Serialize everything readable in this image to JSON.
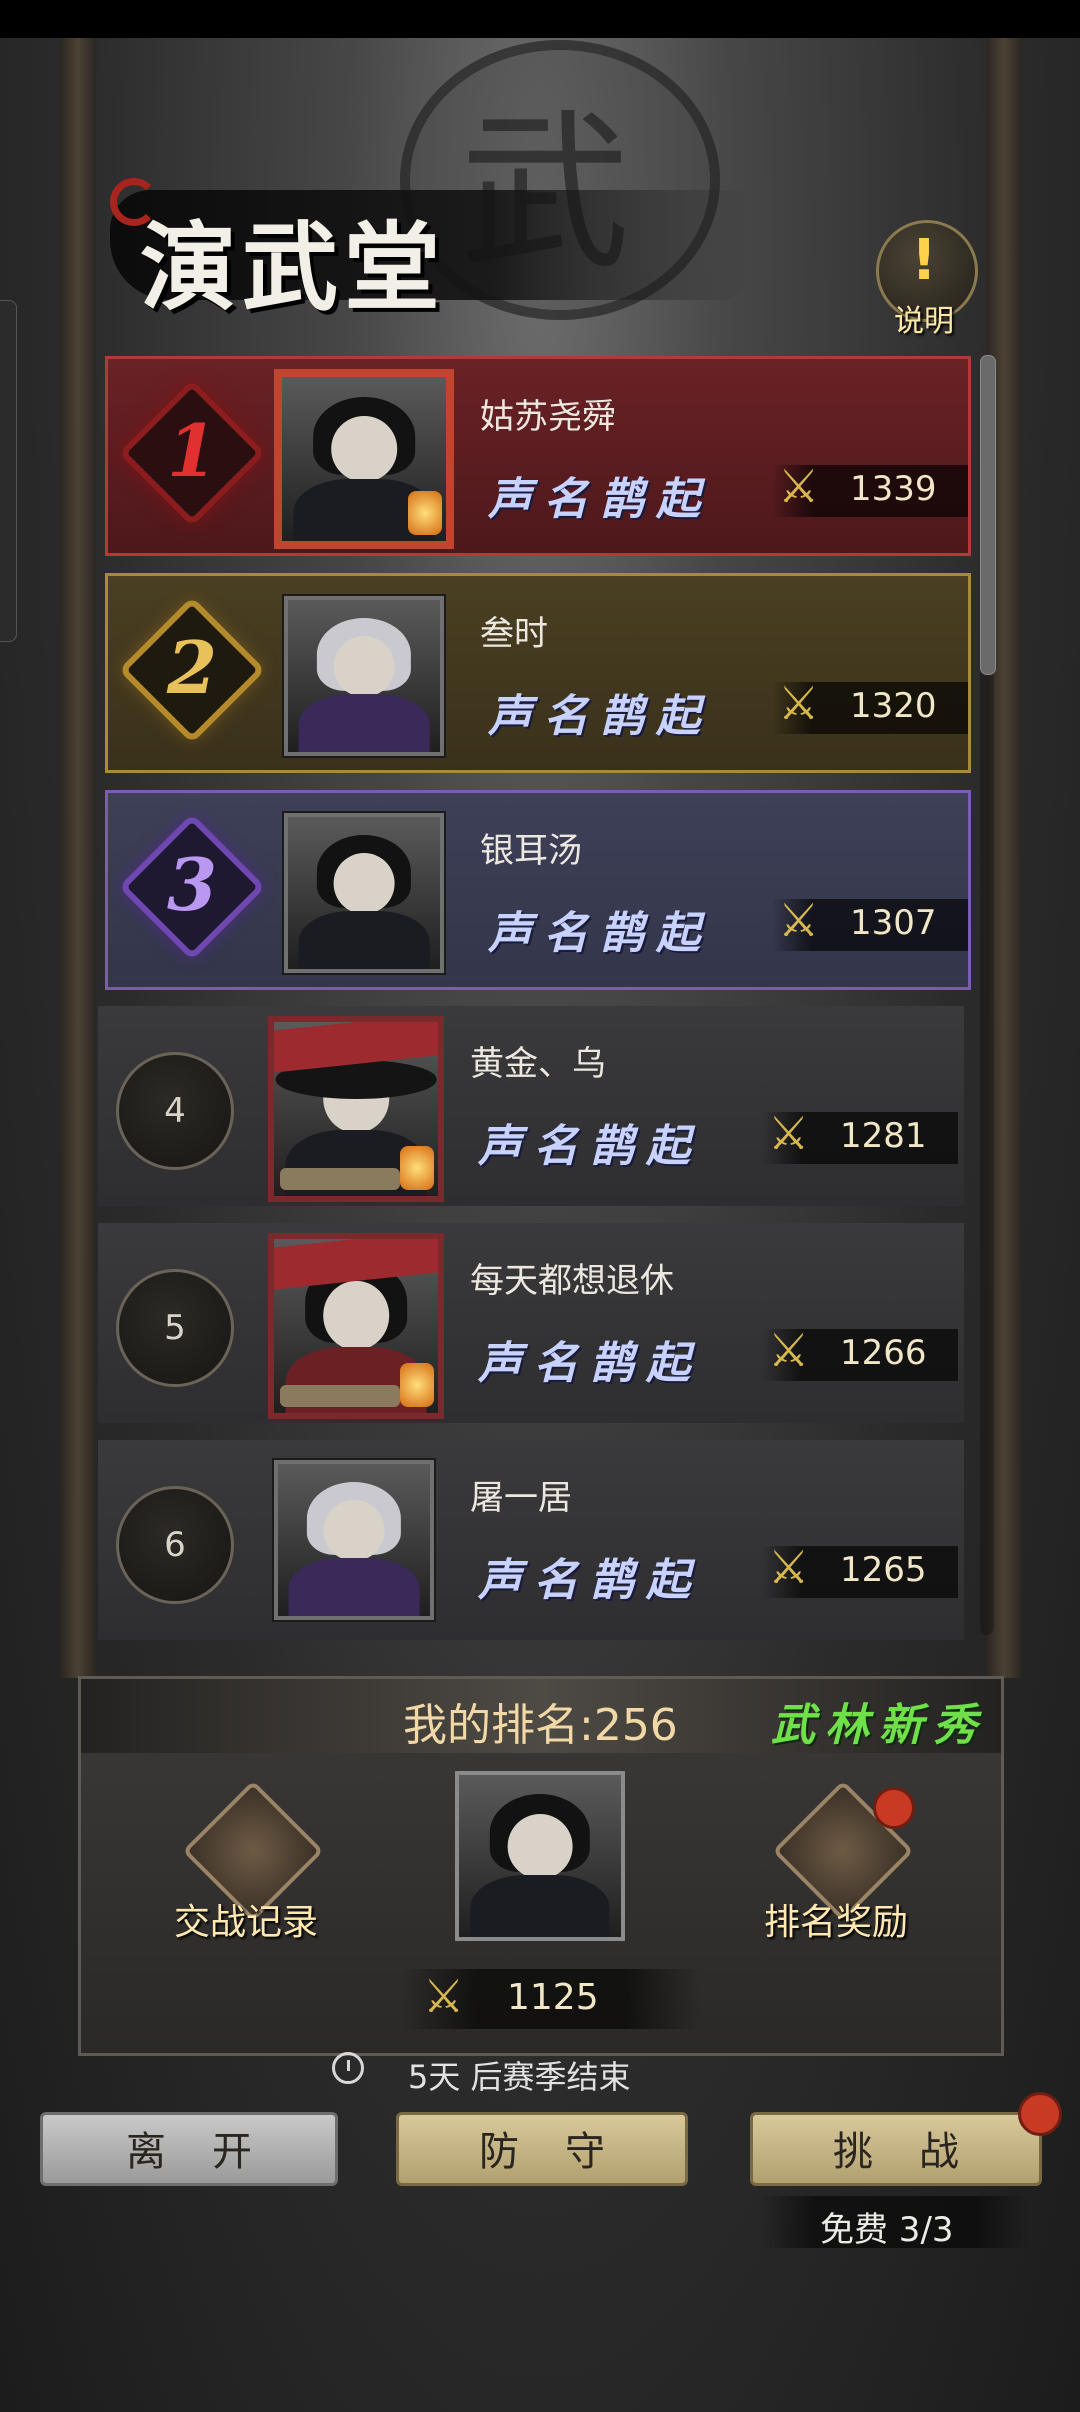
{
  "header": {
    "banner_char": "武",
    "title": "演武堂",
    "help_icon": "exclamation-icon",
    "help_label": "说明"
  },
  "colors": {
    "rank1": "#b23a38",
    "rank2": "#a88a3a",
    "rank3": "#7a5cb4",
    "slogan": "#c8d2ff",
    "title_tag": "#6fe04a"
  },
  "leaderboard": [
    {
      "rank": "1",
      "name": "姑苏尧舜",
      "title": "声名鹊起",
      "icon": "crossed-swords-icon",
      "score": "1339"
    },
    {
      "rank": "2",
      "name": "叁时",
      "title": "声名鹊起",
      "icon": "crossed-swords-icon",
      "score": "1320"
    },
    {
      "rank": "3",
      "name": "银耳汤",
      "title": "声名鹊起",
      "icon": "crossed-swords-icon",
      "score": "1307"
    },
    {
      "rank": "4",
      "name": "黄金、乌",
      "title": "声名鹊起",
      "icon": "crossed-swords-icon",
      "score": "1281"
    },
    {
      "rank": "5",
      "name": "每天都想退休",
      "title": "声名鹊起",
      "icon": "crossed-swords-icon",
      "score": "1266"
    },
    {
      "rank": "6",
      "name": "屠一居",
      "title": "声名鹊起",
      "icon": "crossed-swords-icon",
      "score": "1265"
    }
  ],
  "my_rank": {
    "label": "我的排名:256",
    "title": "武林新秀",
    "battle_log_label": "交战记录",
    "reward_label": "排名奖励",
    "score": "1125"
  },
  "season": {
    "text": "5天 后赛季结束"
  },
  "actions": {
    "leave": "离开",
    "defend": "防守",
    "challenge": "挑战",
    "free_text": "免费 3/3"
  }
}
